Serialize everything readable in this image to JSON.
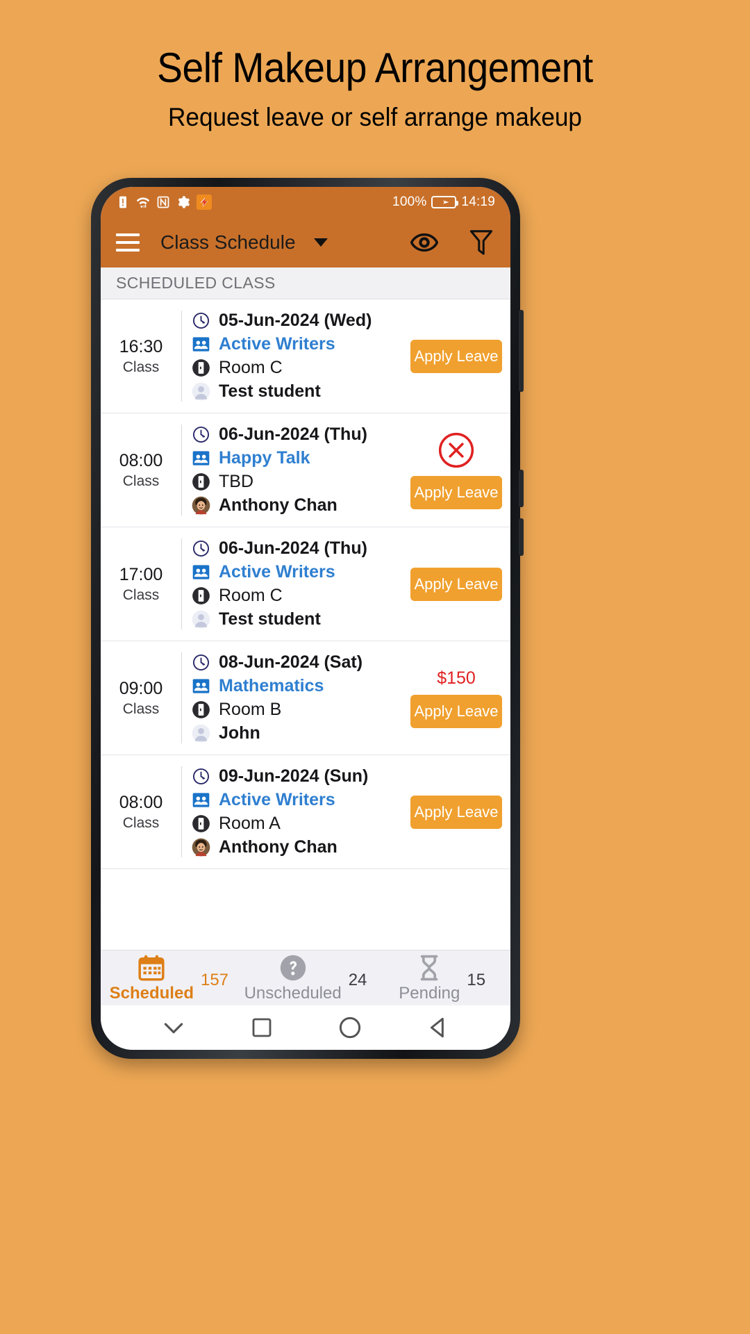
{
  "promo": {
    "title": "Self Makeup Arrangement",
    "subtitle": "Request leave or self arrange makeup",
    "background_color": "#eda754"
  },
  "status_bar": {
    "icons": [
      "sim-alert-icon",
      "wifi-icon",
      "nfc-icon",
      "gear-icon",
      "app-icon"
    ],
    "battery_percent": "100%",
    "time": "14:19"
  },
  "toolbar": {
    "title": "Class Schedule",
    "menu_icon": "hamburger-icon",
    "dropdown_icon": "caret-down-icon",
    "eye_icon": "eye-icon",
    "filter_icon": "filter-icon",
    "background_color": "#c8702a"
  },
  "section": {
    "header": "SCHEDULED CLASS"
  },
  "accent": {
    "orange": "#f0a02e",
    "blue": "#2f7fd0",
    "red": "#e02020"
  },
  "classes": [
    {
      "time": "16:30",
      "time_label": "Class",
      "date": "05-Jun-2024 (Wed)",
      "class_name": "Active Writers",
      "room": "Room C",
      "student": "Test student",
      "avatar": "generic",
      "action_label": "Apply Leave",
      "price": null,
      "cancel": false
    },
    {
      "time": "08:00",
      "time_label": "Class",
      "date": "06-Jun-2024 (Thu)",
      "class_name": "Happy Talk",
      "room": "TBD",
      "student": "Anthony Chan",
      "avatar": "photo",
      "action_label": "Apply Leave",
      "price": null,
      "cancel": true
    },
    {
      "time": "17:00",
      "time_label": "Class",
      "date": "06-Jun-2024 (Thu)",
      "class_name": "Active Writers",
      "room": "Room C",
      "student": "Test student",
      "avatar": "generic",
      "action_label": "Apply Leave",
      "price": null,
      "cancel": false
    },
    {
      "time": "09:00",
      "time_label": "Class",
      "date": "08-Jun-2024 (Sat)",
      "class_name": "Mathematics",
      "room": "Room B",
      "student": "John",
      "avatar": "generic",
      "action_label": "Apply Leave",
      "price": "$150",
      "cancel": false
    },
    {
      "time": "08:00",
      "time_label": "Class",
      "date": "09-Jun-2024 (Sun)",
      "class_name": "Active Writers",
      "room": "Room A",
      "student": "Anthony Chan",
      "avatar": "photo",
      "action_label": "Apply Leave",
      "price": null,
      "cancel": false
    }
  ],
  "bottom_tabs": [
    {
      "label": "Scheduled",
      "count": "157",
      "icon": "calendar-icon",
      "active": true
    },
    {
      "label": "Unscheduled",
      "count": "24",
      "icon": "question-icon",
      "active": false
    },
    {
      "label": "Pending",
      "count": "15",
      "icon": "hourglass-icon",
      "active": false
    }
  ],
  "android_nav": [
    "collapse-icon",
    "square-icon",
    "circle-icon",
    "triangle-back-icon"
  ]
}
